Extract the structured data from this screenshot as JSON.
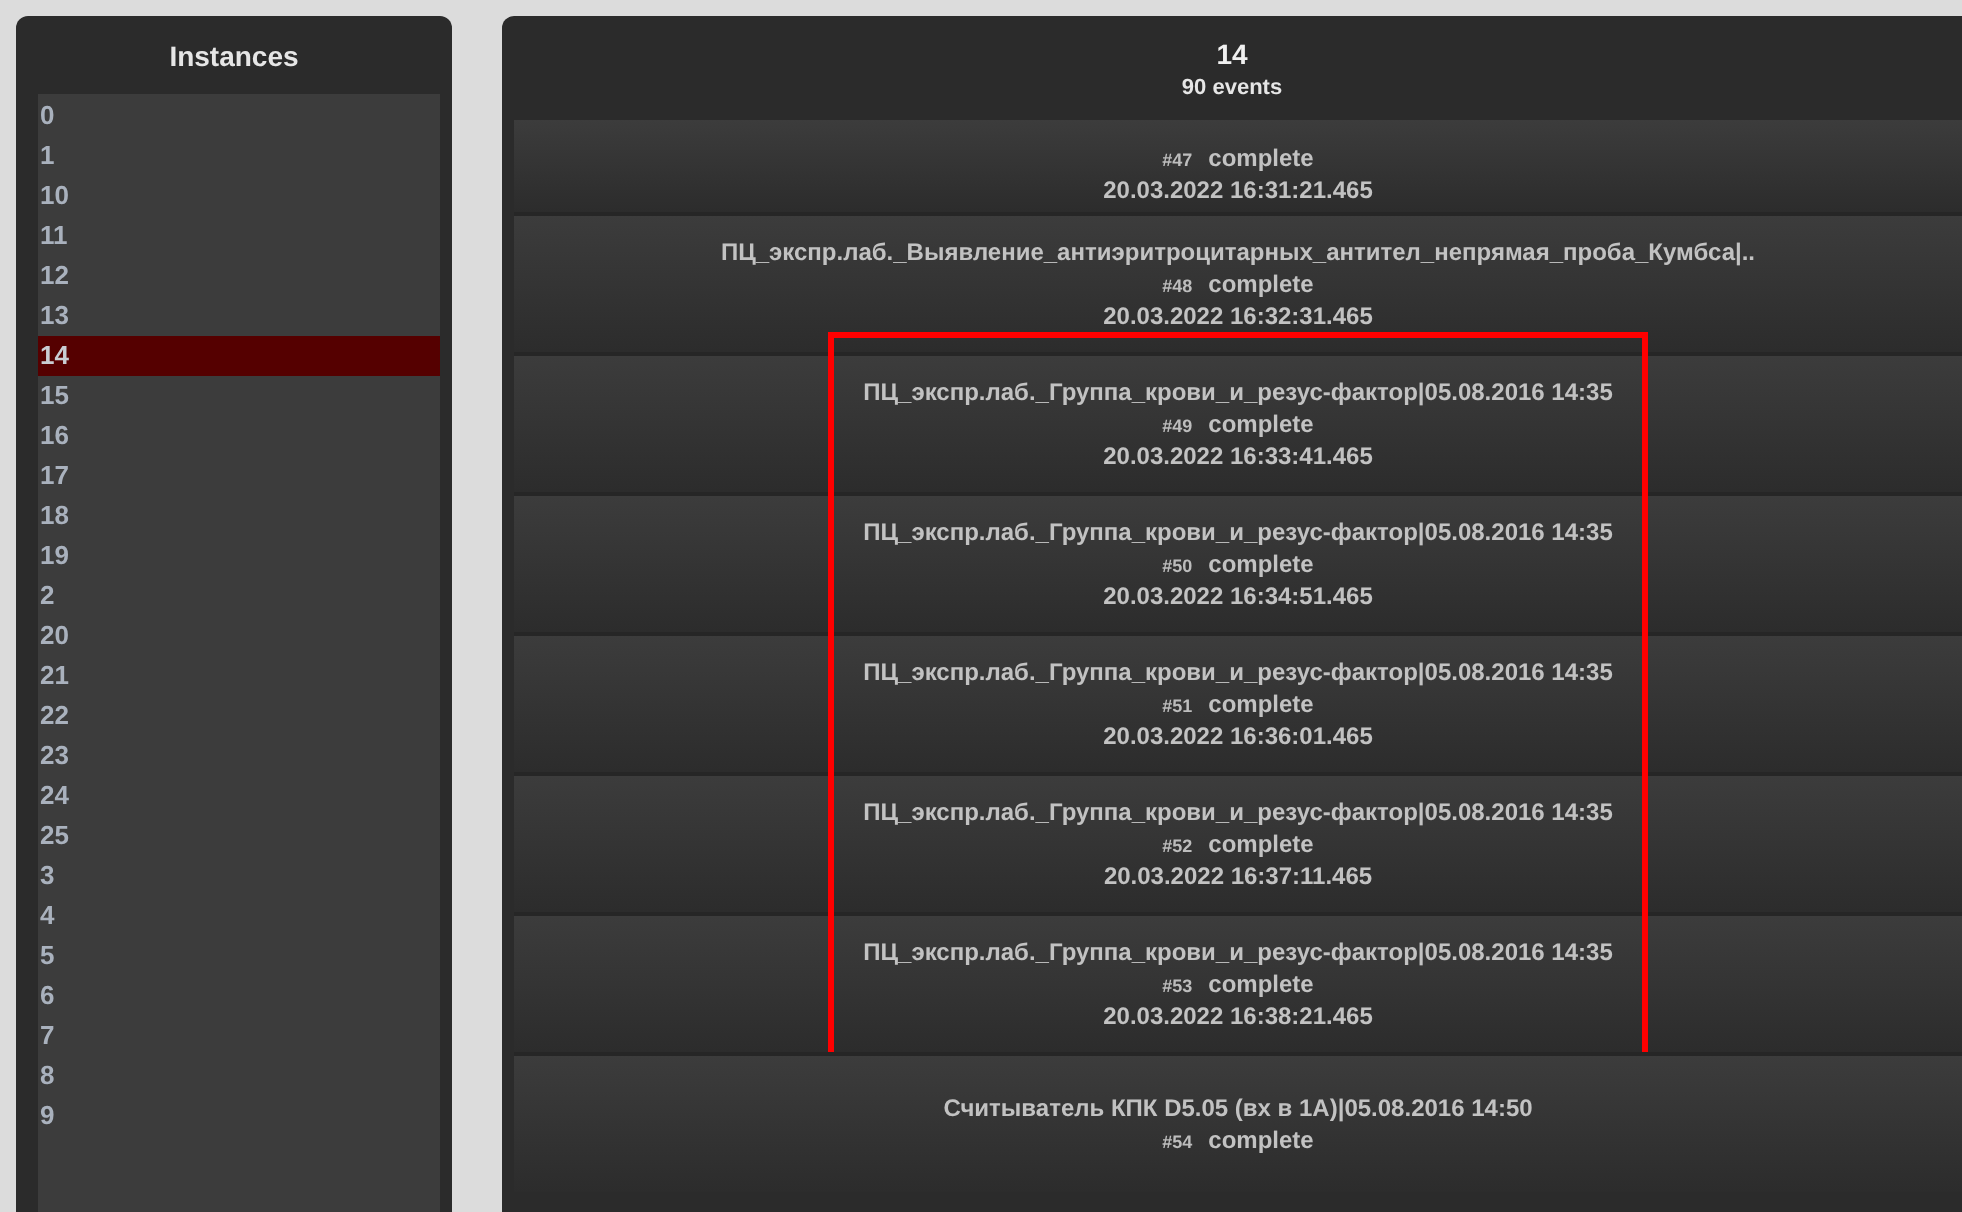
{
  "instances": {
    "title": "Instances",
    "items": [
      {
        "label": "0",
        "selected": false
      },
      {
        "label": "1",
        "selected": false
      },
      {
        "label": "10",
        "selected": false
      },
      {
        "label": "11",
        "selected": false
      },
      {
        "label": "12",
        "selected": false
      },
      {
        "label": "13",
        "selected": false
      },
      {
        "label": "14",
        "selected": true
      },
      {
        "label": "15",
        "selected": false
      },
      {
        "label": "16",
        "selected": false
      },
      {
        "label": "17",
        "selected": false
      },
      {
        "label": "18",
        "selected": false
      },
      {
        "label": "19",
        "selected": false
      },
      {
        "label": "2",
        "selected": false
      },
      {
        "label": "20",
        "selected": false
      },
      {
        "label": "21",
        "selected": false
      },
      {
        "label": "22",
        "selected": false
      },
      {
        "label": "23",
        "selected": false
      },
      {
        "label": "24",
        "selected": false
      },
      {
        "label": "25",
        "selected": false
      },
      {
        "label": "3",
        "selected": false
      },
      {
        "label": "4",
        "selected": false
      },
      {
        "label": "5",
        "selected": false
      },
      {
        "label": "6",
        "selected": false
      },
      {
        "label": "7",
        "selected": false
      },
      {
        "label": "8",
        "selected": false
      },
      {
        "label": "9",
        "selected": false
      }
    ]
  },
  "events_panel": {
    "title": "14",
    "subtitle": "90 events",
    "events": [
      {
        "number": "#47",
        "status": "complete",
        "time": "20.03.2022 16:31:21.465",
        "highlighted": false
      },
      {
        "title": "ПЦ_экспр.лаб._Выявление_антиэритроцитарных_антител_непрямая_проба_Кумбса|..",
        "number": "#48",
        "status": "complete",
        "time": "20.03.2022 16:32:31.465",
        "highlighted": false
      },
      {
        "title": "ПЦ_экспр.лаб._Группа_крови_и_резус-фактор|05.08.2016 14:35",
        "number": "#49",
        "status": "complete",
        "time": "20.03.2022 16:33:41.465",
        "highlighted": true
      },
      {
        "title": "ПЦ_экспр.лаб._Группа_крови_и_резус-фактор|05.08.2016 14:35",
        "number": "#50",
        "status": "complete",
        "time": "20.03.2022 16:34:51.465",
        "highlighted": true
      },
      {
        "title": "ПЦ_экспр.лаб._Группа_крови_и_резус-фактор|05.08.2016 14:35",
        "number": "#51",
        "status": "complete",
        "time": "20.03.2022 16:36:01.465",
        "highlighted": true
      },
      {
        "title": "ПЦ_экспр.лаб._Группа_крови_и_резус-фактор|05.08.2016 14:35",
        "number": "#52",
        "status": "complete",
        "time": "20.03.2022 16:37:11.465",
        "highlighted": true
      },
      {
        "title": "ПЦ_экспр.лаб._Группа_крови_и_резус-фактор|05.08.2016 14:35",
        "number": "#53",
        "status": "complete",
        "time": "20.03.2022 16:38:21.465",
        "highlighted": true
      },
      {
        "title": "Считыватель КПК D5.05 (вх в 1А)|05.08.2016 14:50",
        "number": "#54",
        "status": "complete",
        "highlighted": false
      }
    ]
  }
}
